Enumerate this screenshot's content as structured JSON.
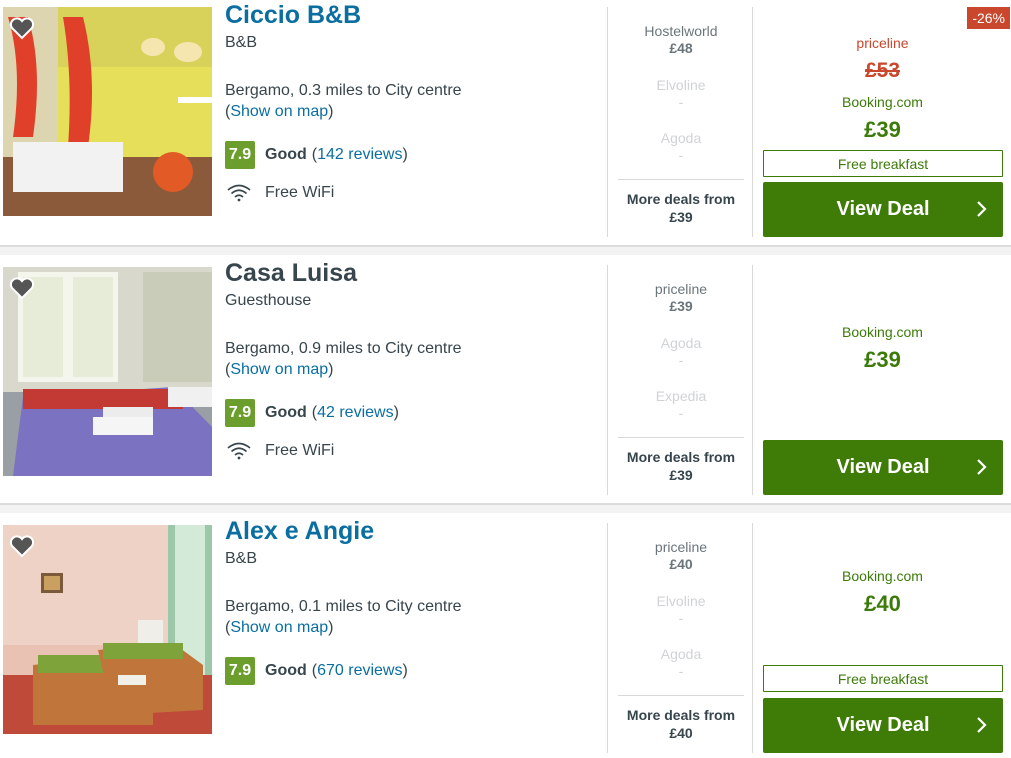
{
  "hotels": [
    {
      "name": "Ciccio B&B",
      "type": "B&B",
      "location": "Bergamo, 0.3 miles to City centre",
      "map_link": "Show on map",
      "score": "7.9",
      "rating_word": "Good",
      "reviews": "142 reviews",
      "amenity": "Free WiFi",
      "deals": [
        {
          "provider": "Hostelworld",
          "price": "£48",
          "muted": false
        },
        {
          "provider": "Elvoline",
          "price": "-",
          "muted": true
        },
        {
          "provider": "Agoda",
          "price": "-",
          "muted": true
        }
      ],
      "more_deals_label": "More deals from",
      "more_deals_price": "£39",
      "badge": "-26%",
      "original_provider": "priceline",
      "original_price": "£53",
      "best_provider": "Booking.com",
      "best_price": "£39",
      "free_breakfast": "Free breakfast",
      "view_deal": "View Deal"
    },
    {
      "name": "Casa Luisa",
      "type": "Guesthouse",
      "location": "Bergamo, 0.9 miles to City centre",
      "map_link": "Show on map",
      "score": "7.9",
      "rating_word": "Good",
      "reviews": "42 reviews",
      "amenity": "Free WiFi",
      "deals": [
        {
          "provider": "priceline",
          "price": "£39",
          "muted": false
        },
        {
          "provider": "Agoda",
          "price": "-",
          "muted": true
        },
        {
          "provider": "Expedia",
          "price": "-",
          "muted": true
        }
      ],
      "more_deals_label": "More deals from",
      "more_deals_price": "£39",
      "best_provider": "Booking.com",
      "best_price": "£39",
      "view_deal": "View Deal"
    },
    {
      "name": "Alex e Angie",
      "type": "B&B",
      "location": "Bergamo, 0.1 miles to City centre",
      "map_link": "Show on map",
      "score": "7.9",
      "rating_word": "Good",
      "reviews": "670 reviews",
      "deals": [
        {
          "provider": "priceline",
          "price": "£40",
          "muted": false
        },
        {
          "provider": "Elvoline",
          "price": "-",
          "muted": true
        },
        {
          "provider": "Agoda",
          "price": "-",
          "muted": true
        }
      ],
      "more_deals_label": "More deals from",
      "more_deals_price": "£40",
      "best_provider": "Booking.com",
      "best_price": "£40",
      "free_breakfast": "Free breakfast",
      "view_deal": "View Deal"
    }
  ],
  "colors": {
    "link": "#0a6ea0",
    "rating_green": "#6b9e2d",
    "deal_green": "#3f7c07",
    "discount_red": "#c9472c"
  },
  "icons": [
    "heart-icon",
    "wifi-icon",
    "chevron-right-icon"
  ]
}
